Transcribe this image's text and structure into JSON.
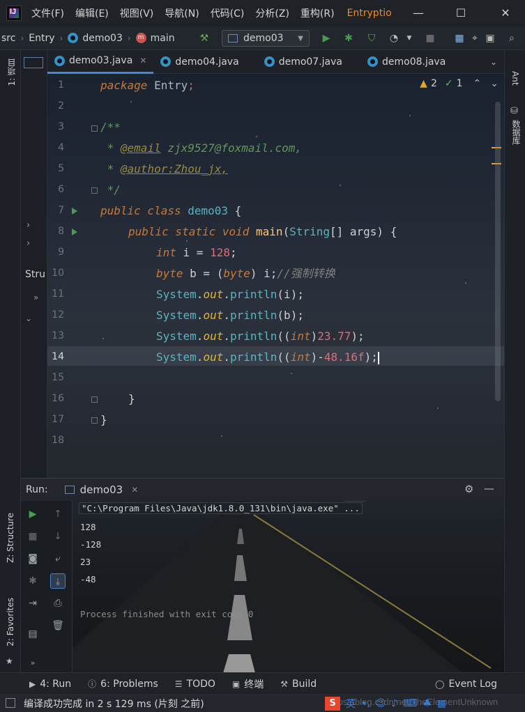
{
  "menubar": {
    "logo": "IJ",
    "items": [
      "文件(F)",
      "编辑(E)",
      "视图(V)",
      "导航(N)",
      "代码(C)",
      "分析(Z)",
      "重构(R)"
    ],
    "project_title": "Entryptio"
  },
  "navbar": {
    "crumbs": [
      "src",
      "Entry",
      "demo03",
      "main"
    ],
    "run_config": "demo03"
  },
  "left_strip": {
    "project_label": "1: 项目",
    "structure_label": "Z: Structure",
    "favorites_label": "2: Favorites"
  },
  "proj_panel": {
    "structure_tab": "Stru"
  },
  "right_strip": {
    "ant_label": "Ant",
    "db_label": "数据库"
  },
  "tabs": [
    {
      "label": "demo03.java",
      "active": true
    },
    {
      "label": "demo04.java",
      "active": false
    },
    {
      "label": "demo07.java",
      "active": false
    },
    {
      "label": "demo08.java",
      "active": false
    }
  ],
  "inspections": {
    "warnings": "2",
    "ok": "1"
  },
  "editor": {
    "current_line": 14,
    "line_numbers": [
      "1",
      "2",
      "3",
      "4",
      "5",
      "6",
      "7",
      "8",
      "9",
      "10",
      "11",
      "12",
      "13",
      "14",
      "15",
      "16",
      "17",
      "18"
    ],
    "code": {
      "l1_kw": "package",
      "l1_pkg": "Entry",
      "l1_end": ";",
      "l3": "/**",
      "l4_star": " * ",
      "l4_tag": "@email",
      "l4_val": " zjx9527@foxmail.com,",
      "l5_star": " * ",
      "l5_tag": "@author:Zhou_jx,",
      "l6": " */",
      "l7_kw": "public class",
      "l7_name": " demo03 ",
      "l7_brace": "{",
      "l8_kw": "public static void",
      "l8_fn": " main",
      "l8_p1": "(",
      "l8_cls": "String",
      "l8_p2": "[] args) {",
      "l9_kw": "int",
      "l9_mid": " i = ",
      "l9_num": "128",
      "l9_end": ";",
      "l10_kw": "byte",
      "l10_mid": " b = (",
      "l10_kw2": "byte",
      "l10_mid2": ") i;",
      "l10_cmt": "//强制转换",
      "sys": "System",
      "dot": ".",
      "out": "out",
      "println": "println",
      "l11_args": "(i);",
      "l12_args": "(b);",
      "l13_open": "((",
      "l13_kw": "int",
      "l13_close": ")",
      "l13_num": "23.77",
      "l13_end": ");",
      "l14_open": "((",
      "l14_kw": "int",
      "l14_close": ")-",
      "l14_num": "48.16f",
      "l14_end": ");",
      "l16": "}",
      "l17": "}"
    }
  },
  "run_panel": {
    "label": "Run:",
    "tab": "demo03",
    "output": [
      "\"C:\\Program Files\\Java\\jdk1.8.0_131\\bin\\java.exe\" ...",
      "128",
      "-128",
      "23",
      "-48",
      "",
      "Process finished with exit code 0"
    ]
  },
  "bottom_tools": [
    {
      "icon": "run-icon",
      "label": "4: Run"
    },
    {
      "icon": "problems-icon",
      "label": "6: Problems"
    },
    {
      "icon": "todo-icon",
      "label": "TODO"
    },
    {
      "icon": "terminal-icon",
      "label": "终端"
    },
    {
      "icon": "build-icon",
      "label": "Build"
    }
  ],
  "event_log": "Event Log",
  "status": {
    "text": "编译成功完成 in 2 s 129 ms (片刻 之前)",
    "ime_label": "英",
    "watermark": "https://blog.csdn.net/TheElementUnknown"
  },
  "colors": {
    "accent": "#4a88c7",
    "project_title": "#f08a24",
    "run_green": "#499c54",
    "keyword": "#cc7832",
    "number": "#e06c75",
    "class": "#56b6c2",
    "function": "#ffc66d"
  }
}
